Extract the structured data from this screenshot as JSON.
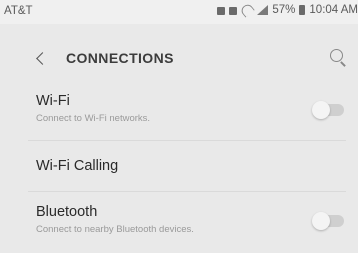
{
  "status_bar": {
    "carrier": "AT&T",
    "battery": "57%",
    "time": "10:04 AM",
    "icons": [
      "notification-icon",
      "notification-icon",
      "wifi-calling-icon",
      "signal-icon",
      "battery-icon"
    ]
  },
  "header": {
    "title": "CONNECTIONS",
    "back_icon": "chevron-left-icon",
    "search_icon": "search-icon"
  },
  "settings": [
    {
      "title": "Wi-Fi",
      "subtitle": "Connect to Wi-Fi networks.",
      "toggle_on": false
    },
    {
      "title": "Wi-Fi Calling"
    },
    {
      "title": "Bluetooth",
      "subtitle": "Connect to nearby Bluetooth devices.",
      "toggle_on": false
    }
  ],
  "colors": {
    "background": "#e9e9e9",
    "text_primary": "#2a2a2a",
    "text_secondary": "#9a9a9a",
    "toggle_off": "#cfcfcf"
  }
}
